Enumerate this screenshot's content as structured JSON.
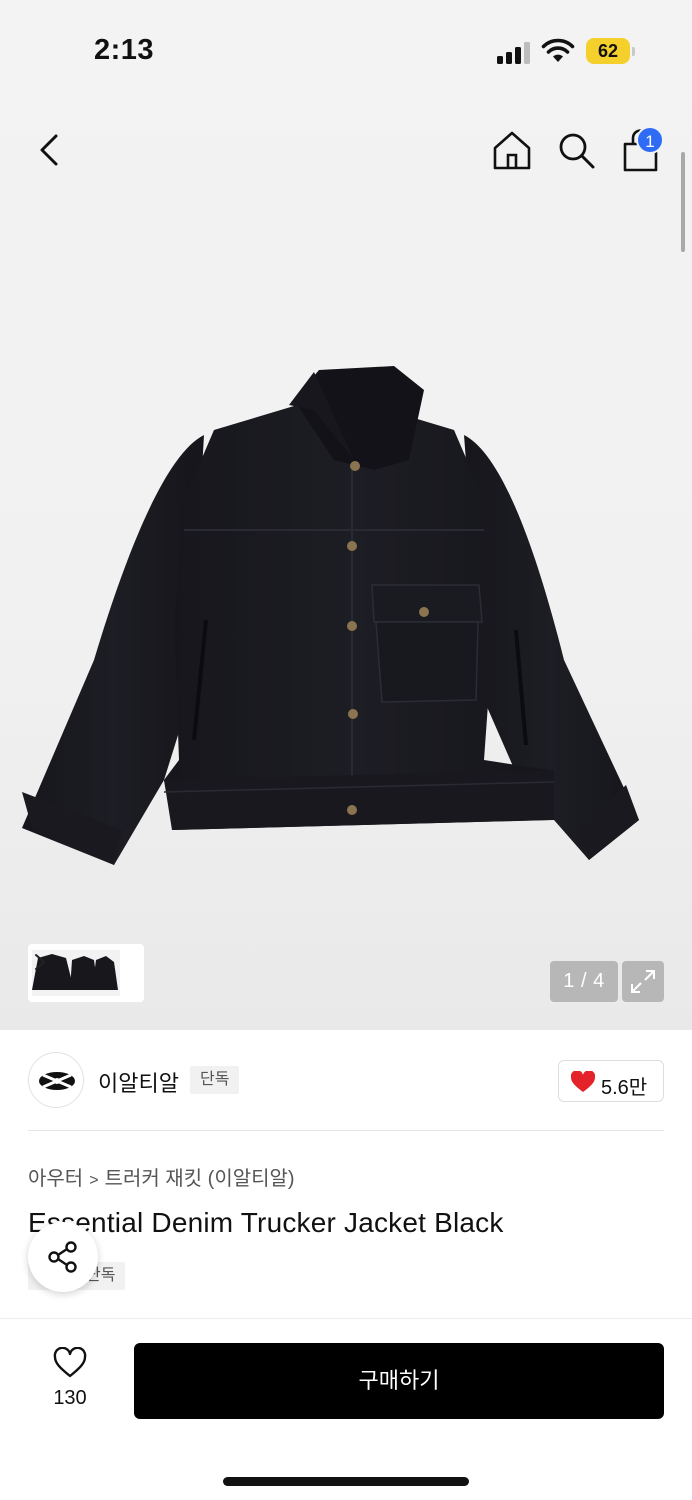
{
  "status_bar": {
    "time": "2:13",
    "battery": "62",
    "battery_color": "#f5d02c"
  },
  "nav": {
    "icons": [
      "chevron-left-icon",
      "home-icon",
      "search-icon",
      "shopping-bag-icon"
    ],
    "cart_badge": "1",
    "badge_color": "#2f6cf6"
  },
  "gallery": {
    "counter": "1 / 4",
    "thumbnails_count": 3,
    "image_subject": "black denim trucker jacket"
  },
  "brand": {
    "name": "이알티알",
    "tag": "단독",
    "likes": "5.6만"
  },
  "product": {
    "breadcrumb": [
      "아우터",
      "트러커 재킷 (이알티알)"
    ],
    "breadcrumb_separator": ">",
    "title": "Essential Denim Trucker Jacket Black",
    "tag": "단독"
  },
  "bottom_bar": {
    "wish_count": "130",
    "buy_label": "구매하기"
  }
}
